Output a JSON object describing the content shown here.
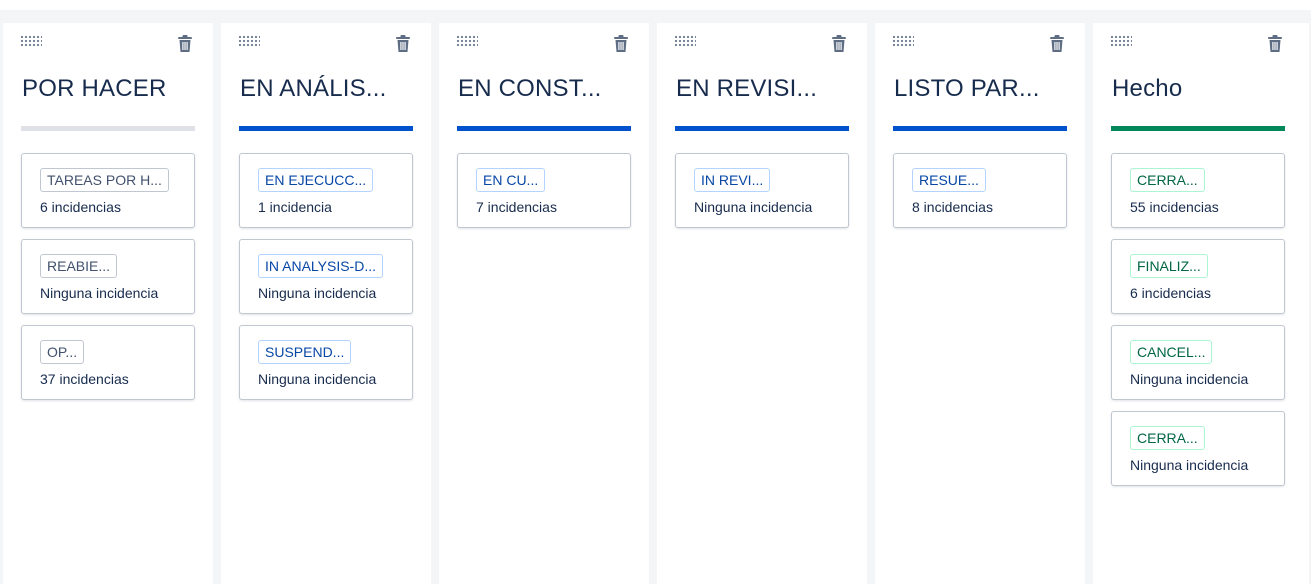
{
  "colors": {
    "todo": "#dfe1e6",
    "progress": "#0052cc",
    "done": "#00875a",
    "lozenge_gray_text": "#42526e",
    "lozenge_gray_border": "#c1c7d0",
    "lozenge_blue_text": "#0747a6",
    "lozenge_blue_border": "#b3d4ff",
    "lozenge_green_text": "#006644",
    "lozenge_green_border": "#abf5d1"
  },
  "icons": {
    "drag": "drag-handle-icon",
    "delete": "trash-icon"
  },
  "columns": [
    {
      "title": "POR HACER",
      "category": "todo",
      "cards": [
        {
          "status": "TAREAS POR H...",
          "count": "6 incidencias"
        },
        {
          "status": "REABIE...",
          "count": "Ninguna incidencia"
        },
        {
          "status": "OP...",
          "count": "37 incidencias"
        }
      ]
    },
    {
      "title": "EN ANÁLIS...",
      "category": "progress",
      "cards": [
        {
          "status": "EN EJECUCC...",
          "count": "1 incidencia"
        },
        {
          "status": "IN ANALYSIS-D...",
          "count": "Ninguna incidencia"
        },
        {
          "status": "SUSPEND...",
          "count": "Ninguna incidencia"
        }
      ]
    },
    {
      "title": "EN CONST...",
      "category": "progress",
      "cards": [
        {
          "status": "EN CU...",
          "count": "7 incidencias"
        }
      ]
    },
    {
      "title": "EN REVISI...",
      "category": "progress",
      "cards": [
        {
          "status": "IN REVI...",
          "count": "Ninguna incidencia"
        }
      ]
    },
    {
      "title": "LISTO PAR...",
      "category": "progress",
      "cards": [
        {
          "status": "RESUE...",
          "count": "8 incidencias"
        }
      ]
    },
    {
      "title": "Hecho",
      "category": "done",
      "cards": [
        {
          "status": "CERRA...",
          "count": "55 incidencias"
        },
        {
          "status": "FINALIZ...",
          "count": "6 incidencias"
        },
        {
          "status": "CANCEL...",
          "count": "Ninguna incidencia"
        },
        {
          "status": "CERRA...",
          "count": "Ninguna incidencia"
        }
      ]
    }
  ]
}
